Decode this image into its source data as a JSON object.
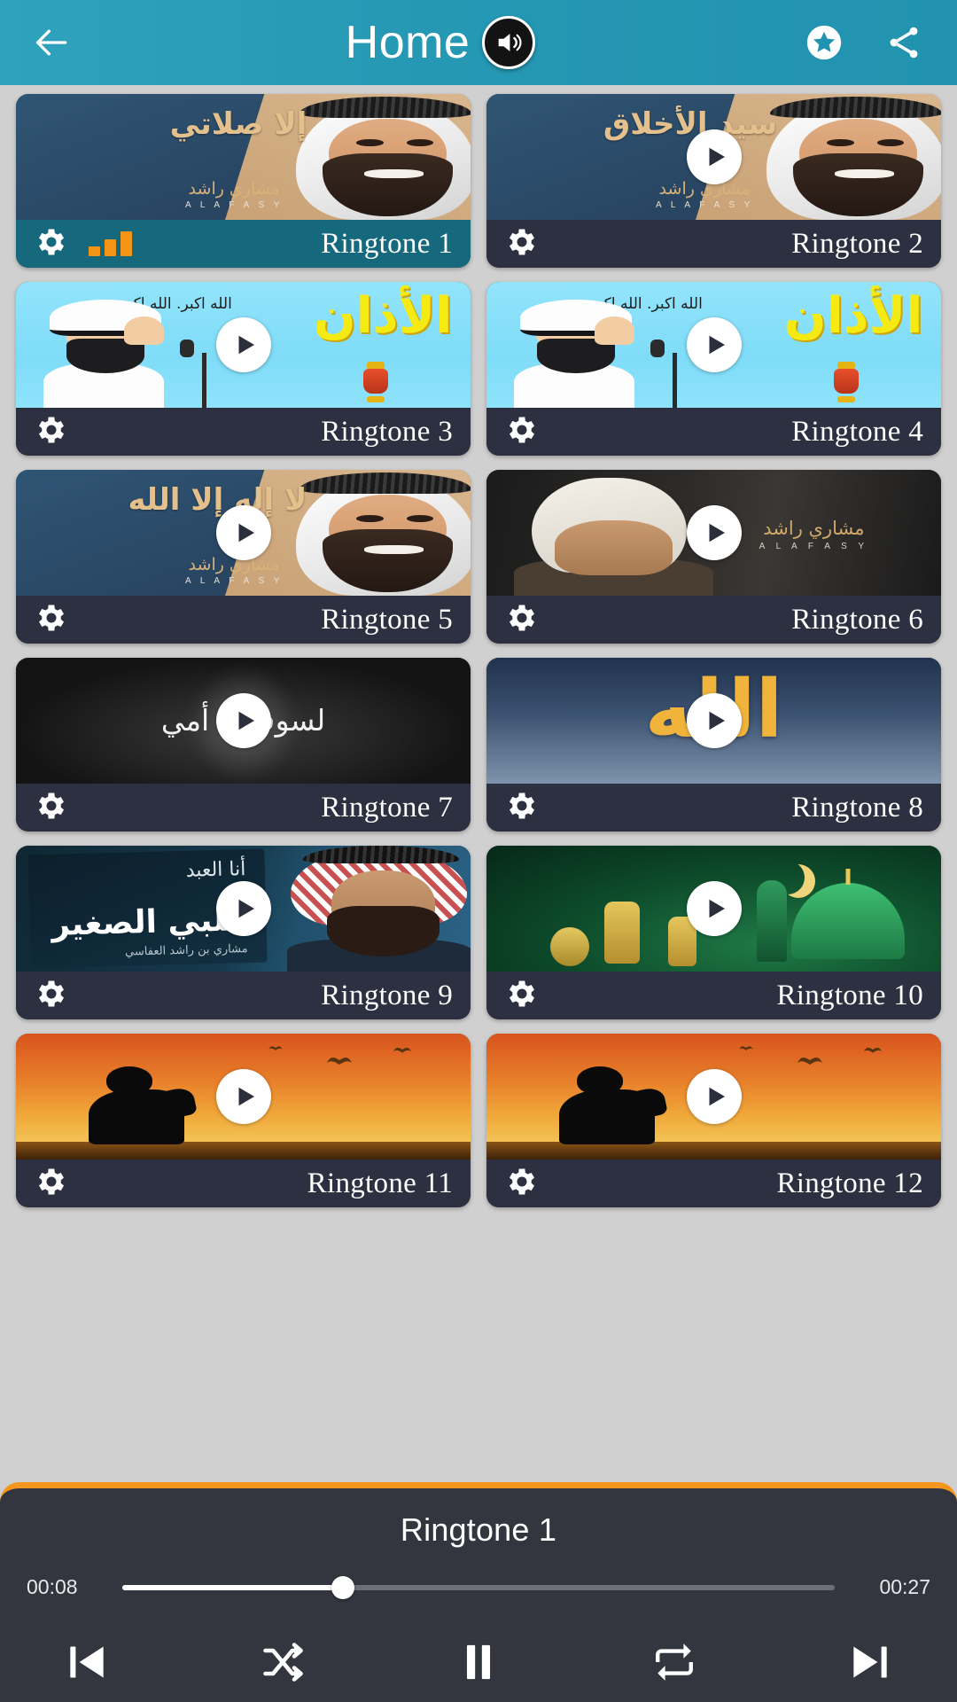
{
  "header": {
    "title": "Home",
    "back_icon": "arrow-left-icon",
    "speaker_icon": "speaker-icon",
    "favorite_icon": "star-circle-icon",
    "share_icon": "share-icon",
    "background_color": "#2193b0"
  },
  "theme": {
    "accent_orange": "#f5961e",
    "active_label_teal": "#16687c",
    "label_dark": "#2c3040",
    "page_background": "#d0d0d0"
  },
  "grid": {
    "cards": [
      {
        "label": "Ringtone 1",
        "art": "alafasy",
        "arabic": "إلا\nصلاتي",
        "brand_ar": "مشاري راشد",
        "brand_en": "A L A F A S Y",
        "active": true,
        "show_play": false,
        "show_eq": true
      },
      {
        "label": "Ringtone 2",
        "art": "alafasy",
        "arabic": "سيد\nالأخلاق",
        "brand_ar": "مشاري راشد",
        "brand_en": "A L A F A S Y",
        "active": false,
        "show_play": true,
        "show_eq": false
      },
      {
        "label": "Ringtone 3",
        "art": "adhan",
        "arabic": "الأذان",
        "takbir": "الله اكبر.\nالله اكبر.",
        "active": false,
        "show_play": true,
        "show_eq": false
      },
      {
        "label": "Ringtone 4",
        "art": "adhan",
        "arabic": "الأذان",
        "takbir": "الله اكبر.\nالله اكبر.",
        "active": false,
        "show_play": true,
        "show_eq": false
      },
      {
        "label": "Ringtone 5",
        "art": "alafasy",
        "arabic": "لا إله إلا\nالله",
        "brand_ar": "مشاري راشد",
        "brand_en": "A L A F A S Y",
        "active": false,
        "show_play": true,
        "show_eq": false
      },
      {
        "label": "Ringtone 6",
        "art": "dua",
        "brand_ar": "مشاري راشد",
        "brand_en": "A L A F A S Y",
        "active": false,
        "show_play": true,
        "show_eq": false
      },
      {
        "label": "Ringtone 7",
        "art": "mother",
        "arabic": "لسوف يا أمي",
        "active": false,
        "show_play": true,
        "show_eq": false
      },
      {
        "label": "Ringtone 8",
        "art": "allah",
        "arabic": "الله",
        "active": false,
        "show_play": true,
        "show_eq": false
      },
      {
        "label": "Ringtone 9",
        "art": "qalbi",
        "arabic_top": "أنا العبد",
        "arabic_mid": "قلبي الصغير",
        "arabic_sub": "مشاري بن راشد العفاسي",
        "active": false,
        "show_play": true,
        "show_eq": false
      },
      {
        "label": "Ringtone 10",
        "art": "mosque",
        "active": false,
        "show_play": true,
        "show_eq": false
      },
      {
        "label": "Ringtone 11",
        "art": "sunset",
        "active": false,
        "show_play": true,
        "show_eq": false
      },
      {
        "label": "Ringtone 12",
        "art": "sunset",
        "active": false,
        "show_play": true,
        "show_eq": false
      }
    ],
    "settings_icon": "gear-icon",
    "play_icon": "play-icon",
    "equalizer_icon": "equalizer-bars-icon"
  },
  "player": {
    "now_playing": "Ringtone 1",
    "elapsed": "00:08",
    "duration": "00:27",
    "progress_percent": 31,
    "controls": [
      {
        "name": "previous-button",
        "icon": "skip-previous-icon"
      },
      {
        "name": "shuffle-button",
        "icon": "shuffle-icon"
      },
      {
        "name": "pause-button",
        "icon": "pause-icon"
      },
      {
        "name": "repeat-button",
        "icon": "repeat-icon"
      },
      {
        "name": "next-button",
        "icon": "skip-next-icon"
      }
    ]
  }
}
